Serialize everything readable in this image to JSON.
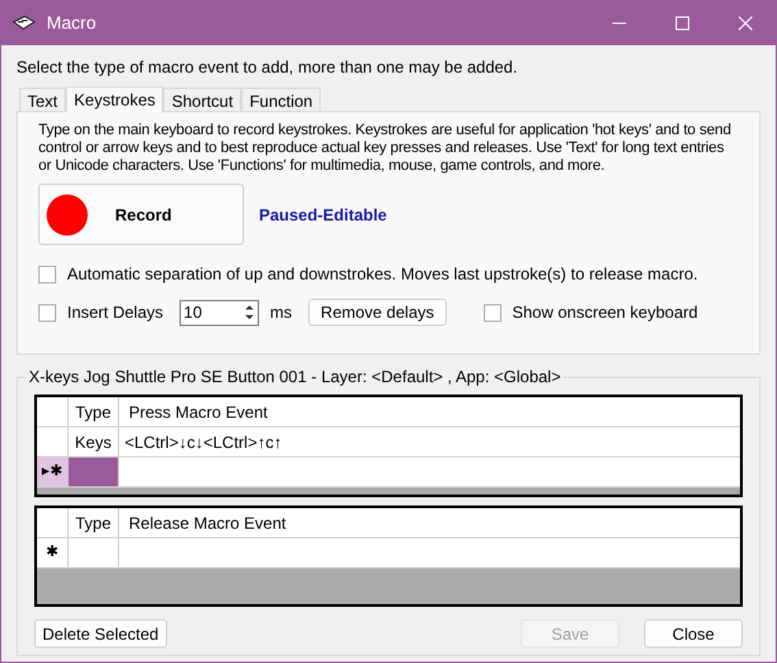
{
  "window": {
    "title": "Macro"
  },
  "instruction": "Select the type of macro event to add, more than one may be added.",
  "tabs": [
    {
      "label": "Text",
      "selected": false
    },
    {
      "label": "Keystrokes",
      "selected": true
    },
    {
      "label": "Shortcut",
      "selected": false
    },
    {
      "label": "Function",
      "selected": false
    }
  ],
  "description": "Type on the main keyboard to record keystrokes. Keystrokes are useful for application 'hot keys' and to send control or arrow keys and to best reproduce actual key presses and releases. Use 'Text' for long text entries or Unicode characters. Use 'Functions' for multimedia, mouse, game controls, and more.",
  "record_button": "Record",
  "status": "Paused-Editable",
  "auto_separation": {
    "label": "Automatic separation of up and downstrokes. Moves last upstroke(s) to release macro.",
    "checked": false
  },
  "insert_delays": {
    "label": "Insert Delays",
    "checked": false
  },
  "delay_value": "10",
  "delay_unit": "ms",
  "remove_delays_button": "Remove delays",
  "onscreen_keyboard": {
    "label": "Show onscreen keyboard",
    "checked": false
  },
  "group_title": "X-keys Jog Shuttle Pro SE Button 001 - Layer: <Default> , App: <Global>",
  "grids": [
    {
      "columns": [
        "Type",
        "Press Macro Event"
      ],
      "rows": [
        {
          "marker": "",
          "type": "Keys",
          "event": "<LCtrl>↓c↓<LCtrl>↑c↑",
          "selected": false
        },
        {
          "marker": "▸✱",
          "type": "",
          "event": "",
          "selected": true
        }
      ]
    },
    {
      "columns": [
        "Type",
        "Release Macro Event"
      ],
      "rows": [
        {
          "marker": "✱",
          "type": "",
          "event": "",
          "selected": false
        }
      ]
    }
  ],
  "buttons": {
    "delete": "Delete Selected",
    "save": {
      "label": "Save",
      "disabled": true
    },
    "close": "Close"
  }
}
